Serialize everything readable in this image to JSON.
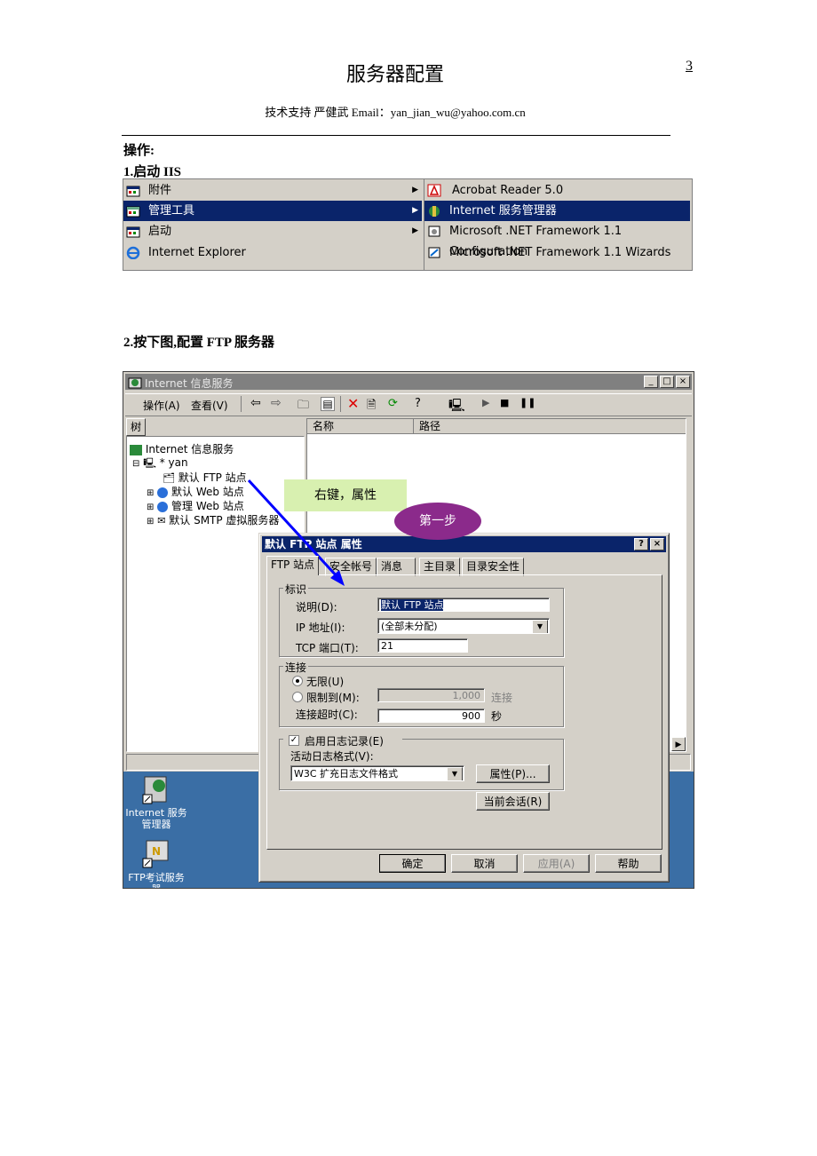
{
  "header": {
    "title": "服务器配置",
    "page_number": "3",
    "subtitle": "技术支持  严健武 Email：yan_jian_wu@yahoo.com.cn"
  },
  "body": {
    "operation": "操作:",
    "step1": "1.启动 IIS",
    "step2": "2.按下图,配置 FTP 服务器"
  },
  "start_menu": {
    "left_items": [
      "附件",
      "管理工具",
      "启动",
      "Internet Explorer"
    ],
    "right_items": [
      "Acrobat Reader 5.0",
      "Internet 服务管理器",
      "Microsoft .NET Framework 1.1 Configuration",
      "Microsoft .NET Framework 1.1 Wizards"
    ]
  },
  "iis_window": {
    "title": "Internet 信息服务",
    "menu": [
      "操作(A)",
      "查看(V)"
    ],
    "tree_tab": "树",
    "columns": [
      "名称",
      "路径"
    ],
    "tree": [
      "Internet 信息服务",
      "* yan",
      "默认 FTP 站点",
      "默认 Web 站点",
      "管理 Web 站点",
      "默认 SMTP 虚拟服务器"
    ],
    "desktop_icons": [
      "Internet 服务\n管理器",
      "FTP考试服务\n器"
    ]
  },
  "annotations": {
    "callout": "右键，属性",
    "step_bubble": "第一步",
    "arrow_color": "#0000ff",
    "bubble_color": "#8b2a8b",
    "callout_color": "#d8f0b0"
  },
  "dialog": {
    "title": "默认 FTP 站点 属性",
    "tabs": [
      "FTP 站点",
      "安全帐号",
      "消息",
      "主目录",
      "目录安全性"
    ],
    "identity": {
      "group": "标识",
      "desc_label": "说明(D):",
      "desc_value": "默认 FTP 站点",
      "ip_label": "IP 地址(I):",
      "ip_value": "(全部未分配)",
      "port_label": "TCP 端口(T):",
      "port_value": "21"
    },
    "connection": {
      "group": "连接",
      "unlimited": "无限(U)",
      "limited": "限制到(M):",
      "limit_value": "1,000",
      "limit_unit": "连接",
      "timeout_label": "连接超时(C):",
      "timeout_value": "900",
      "timeout_unit": "秒"
    },
    "logging": {
      "enable": "启用日志记录(E)",
      "format_label": "活动日志格式(V):",
      "format_value": "W3C 扩充日志文件格式",
      "props_button": "属性(P)..."
    },
    "sessions_button": "当前会话(R)",
    "buttons": {
      "ok": "确定",
      "cancel": "取消",
      "apply": "应用(A)",
      "help": "帮助"
    }
  }
}
